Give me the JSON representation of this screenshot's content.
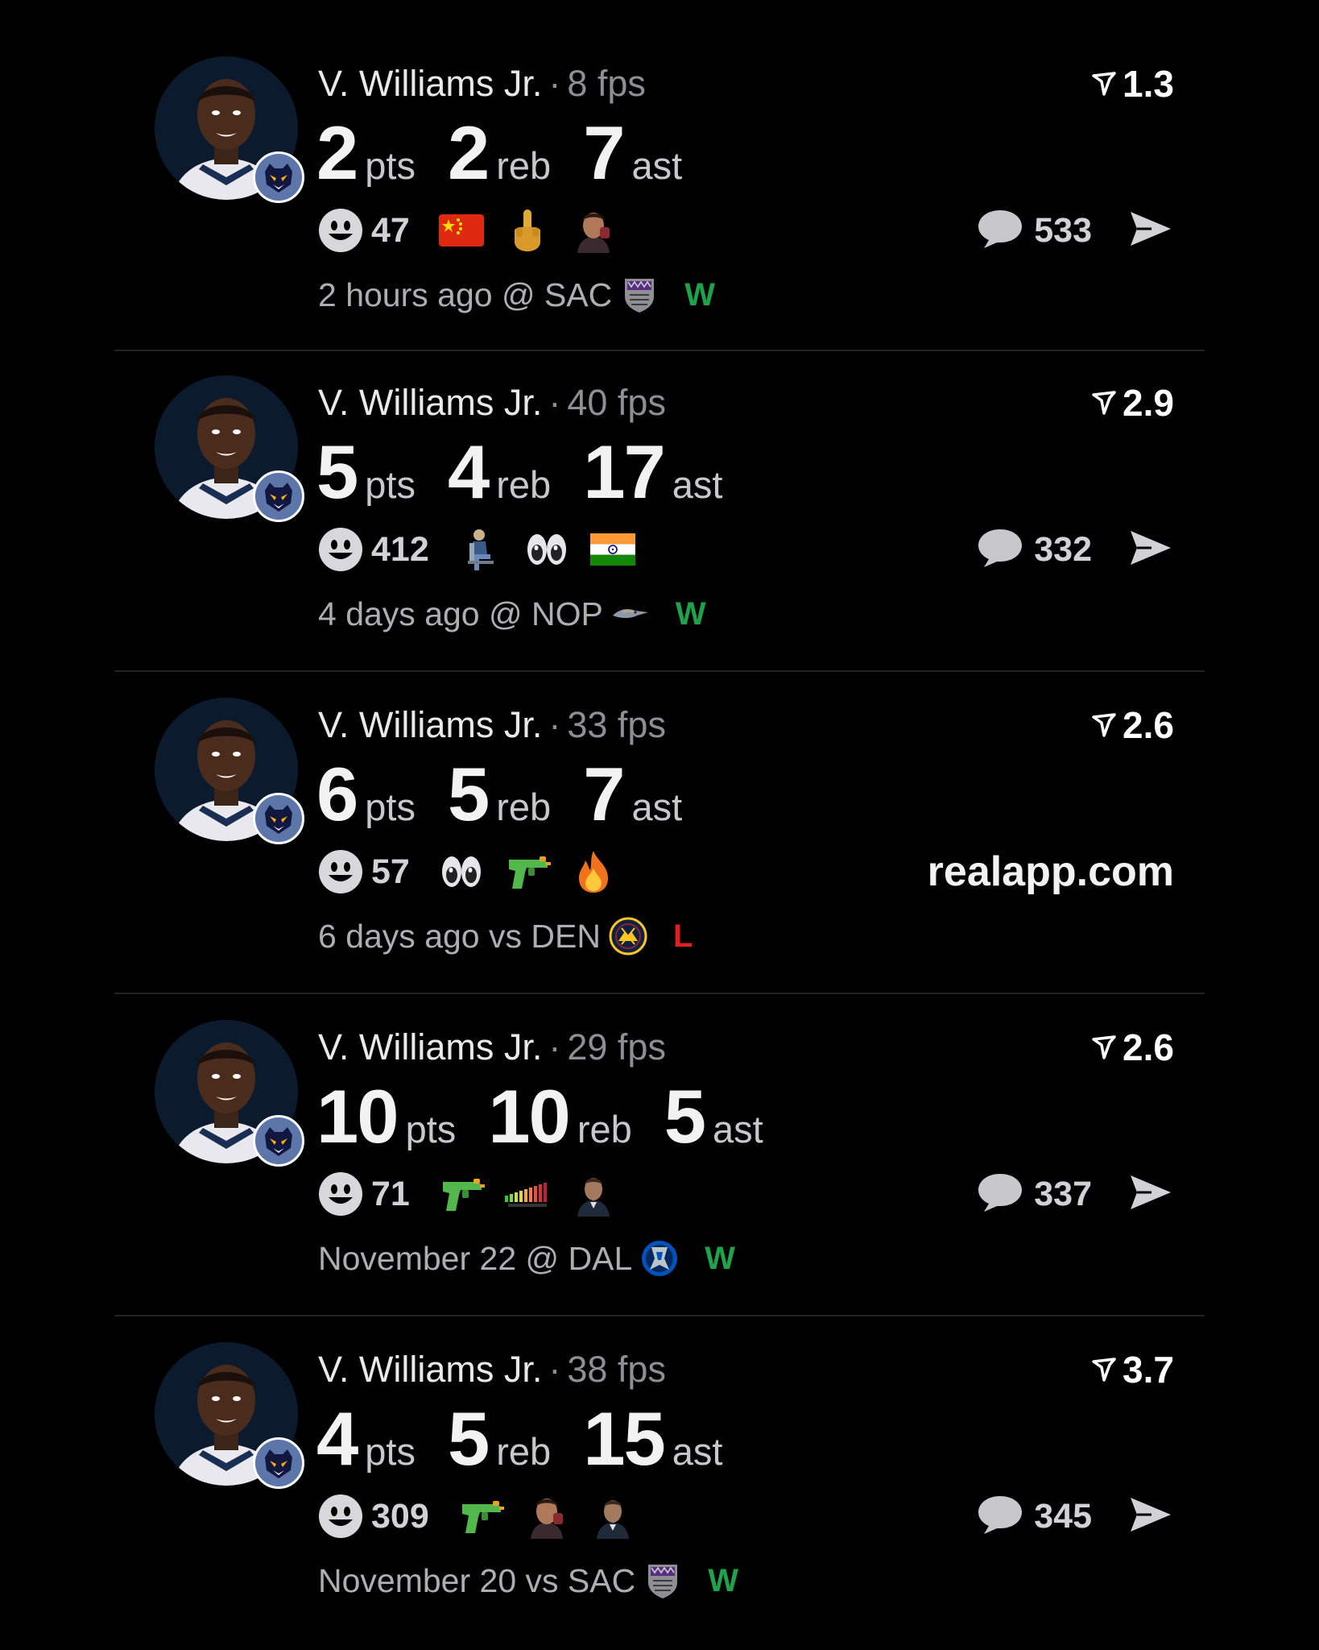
{
  "colors": {
    "background": "#000000",
    "win": "#1fa34a",
    "loss": "#e02020",
    "muted": "#8e8e93"
  },
  "posts": [
    {
      "player": "V. Williams Jr.",
      "separator": "·",
      "fps": "8 fps",
      "rating": "1.3",
      "stats": [
        {
          "value": "2",
          "label": "pts"
        },
        {
          "value": "2",
          "label": "reb"
        },
        {
          "value": "7",
          "label": "ast"
        }
      ],
      "reaction_count": "47",
      "reactions": [
        "china-flag-emoji",
        "middle-finger-emoji",
        "sticker-face-emoji"
      ],
      "comment_count": "533",
      "time": "2 hours ago @ SAC",
      "opponent_logo": "kings-logo",
      "result": "W"
    },
    {
      "player": "V. Williams Jr.",
      "separator": "·",
      "fps": "40 fps",
      "rating": "2.9",
      "stats": [
        {
          "value": "5",
          "label": "pts"
        },
        {
          "value": "4",
          "label": "reb"
        },
        {
          "value": "17",
          "label": "ast"
        }
      ],
      "reaction_count": "412",
      "reactions": [
        "sitting-person-emoji",
        "eyes-emoji",
        "india-flag-emoji"
      ],
      "comment_count": "332",
      "time": "4 days ago @ NOP",
      "opponent_logo": "pelicans-logo",
      "result": "W"
    },
    {
      "player": "V. Williams Jr.",
      "separator": "·",
      "fps": "33 fps",
      "rating": "2.6",
      "stats": [
        {
          "value": "6",
          "label": "pts"
        },
        {
          "value": "5",
          "label": "reb"
        },
        {
          "value": "7",
          "label": "ast"
        }
      ],
      "reaction_count": "57",
      "reactions": [
        "eyes-emoji",
        "water-pistol-emoji",
        "fire-emoji"
      ],
      "watermark": "realapp.com",
      "time": "6 days ago vs DEN",
      "opponent_logo": "nuggets-logo",
      "result": "L"
    },
    {
      "player": "V. Williams Jr.",
      "separator": "·",
      "fps": "29 fps",
      "rating": "2.6",
      "stats": [
        {
          "value": "10",
          "label": "pts"
        },
        {
          "value": "10",
          "label": "reb"
        },
        {
          "value": "5",
          "label": "ast"
        }
      ],
      "reaction_count": "71",
      "reactions": [
        "water-pistol-emoji",
        "meter-sticker-emoji",
        "person-sticker-emoji"
      ],
      "comment_count": "337",
      "time": "November 22 @ DAL",
      "opponent_logo": "mavericks-logo",
      "result": "W"
    },
    {
      "player": "V. Williams Jr.",
      "separator": "·",
      "fps": "38 fps",
      "rating": "3.7",
      "stats": [
        {
          "value": "4",
          "label": "pts"
        },
        {
          "value": "5",
          "label": "reb"
        },
        {
          "value": "15",
          "label": "ast"
        }
      ],
      "reaction_count": "309",
      "reactions": [
        "water-pistol-emoji",
        "sticker-face-emoji",
        "person-sticker-emoji"
      ],
      "comment_count": "345",
      "time": "November 20 vs SAC",
      "opponent_logo": "kings-logo",
      "result": "W"
    }
  ]
}
